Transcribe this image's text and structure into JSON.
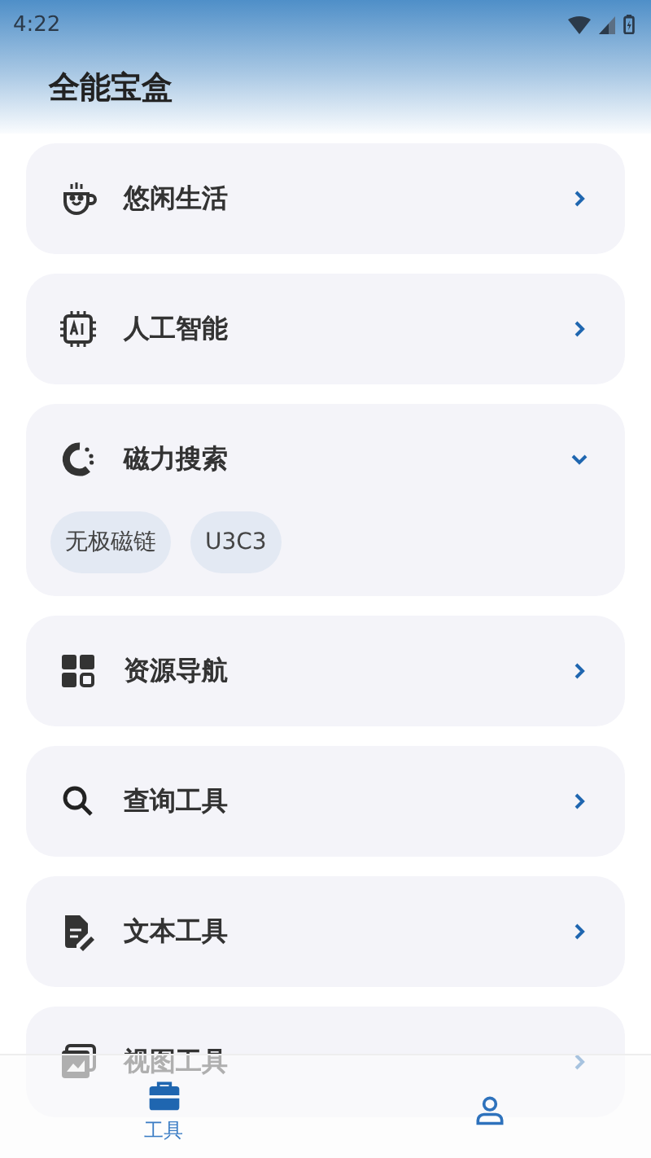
{
  "status_bar": {
    "time": "4:22"
  },
  "header": {
    "title": "全能宝盒"
  },
  "categories": [
    {
      "kind": "cup",
      "label": "悠闲生活",
      "expanded": false
    },
    {
      "kind": "chip",
      "label": "人工智能",
      "expanded": false
    },
    {
      "kind": "magnet",
      "label": "磁力搜索",
      "expanded": true,
      "links": [
        "无极磁链",
        "U3C3"
      ]
    },
    {
      "kind": "grid",
      "label": "资源导航",
      "expanded": false
    },
    {
      "kind": "search",
      "label": "查询工具",
      "expanded": false
    },
    {
      "kind": "document",
      "label": "文本工具",
      "expanded": false
    },
    {
      "kind": "image",
      "label": "视图工具",
      "expanded": false
    }
  ],
  "bottom_nav": [
    {
      "kind": "toolbox",
      "label": "工具",
      "selected": true
    },
    {
      "kind": "person",
      "selected": false
    }
  ]
}
